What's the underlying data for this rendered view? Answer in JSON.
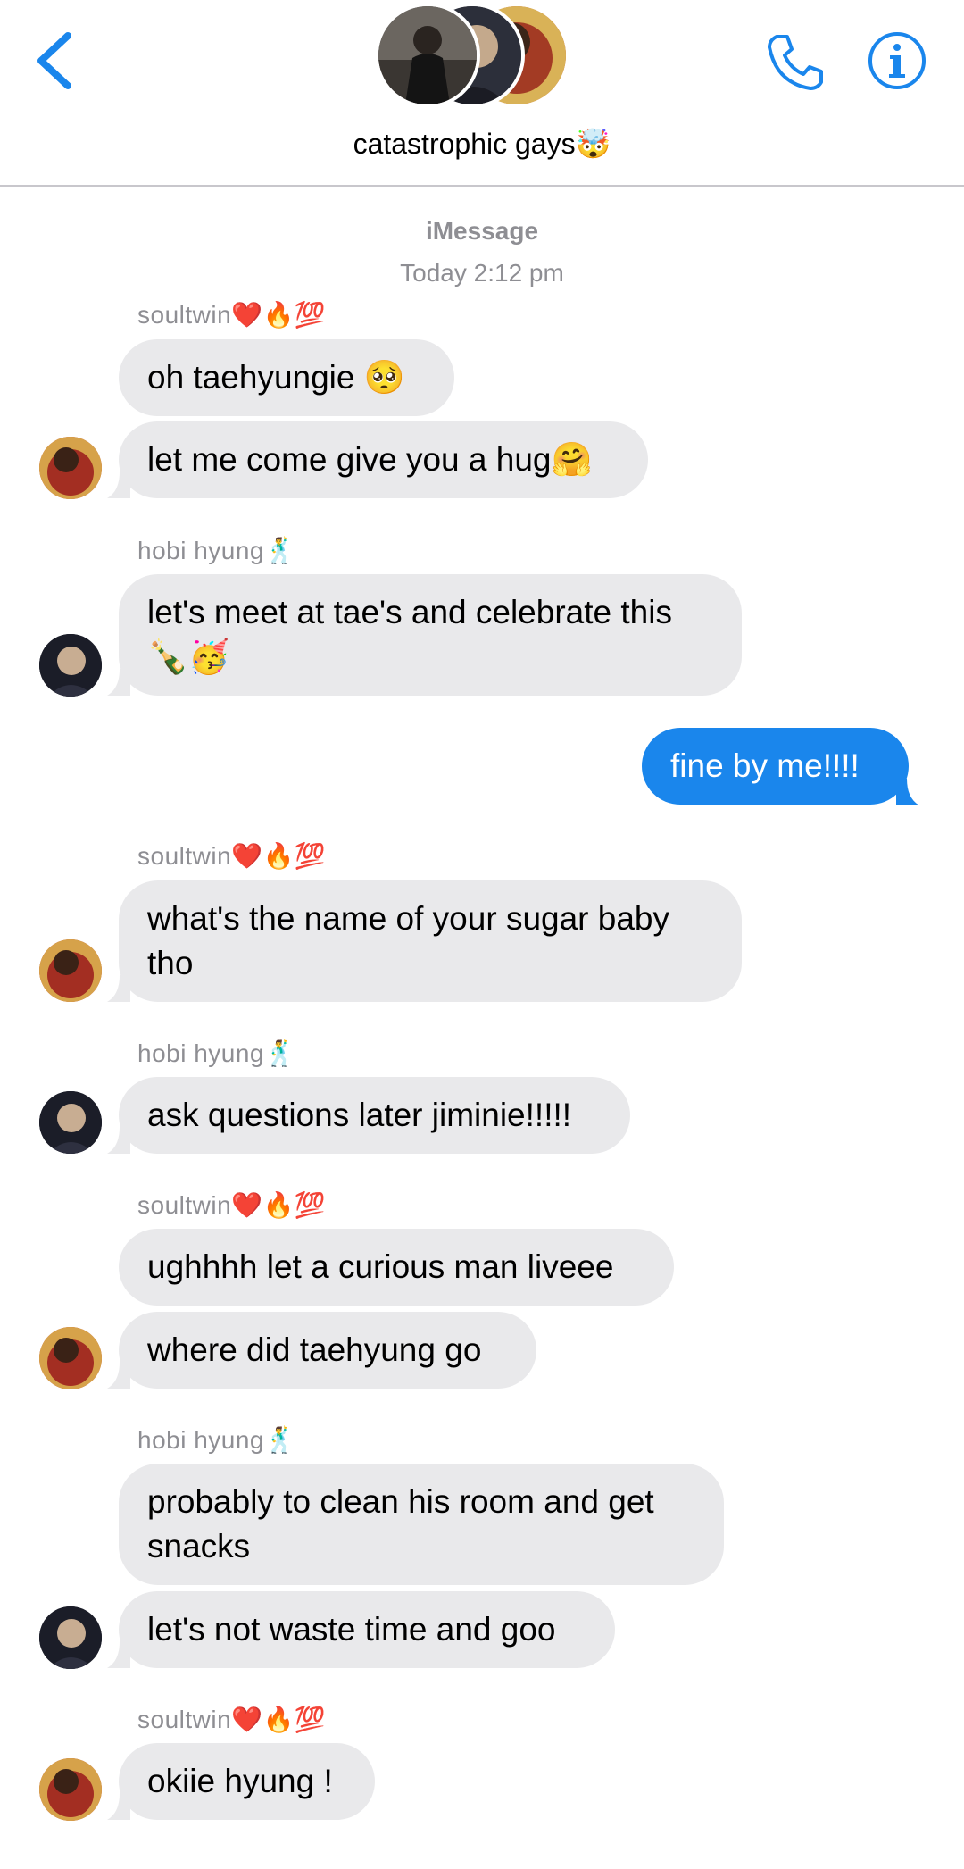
{
  "header": {
    "chat_title": "catastrophic gays🤯",
    "back_label": "Back",
    "colors": {
      "accent": "#1a86ec",
      "incoming_bubble": "#e9e9eb",
      "outgoing_bubble": "#1a86ec",
      "meta_text": "#8e8e93"
    }
  },
  "thread": {
    "service": "iMessage",
    "timestamp": "Today 2:12 pm"
  },
  "senders": {
    "soultwin": "soultwin❤️🔥💯",
    "hobi": "hobi hyung🕺"
  },
  "messages": [
    {
      "text": "oh taehyungie 🥺"
    },
    {
      "text": "let me come give you a hug🤗"
    },
    {
      "text": "let's meet at tae's and celebrate this 🍾🥳"
    },
    {
      "text": "fine by me!!!!"
    },
    {
      "text": "what's the name of your sugar baby tho"
    },
    {
      "text": "ask questions later jiminie!!!!!"
    },
    {
      "text": "ughhhh let a curious man liveee"
    },
    {
      "text": "where did taehyung go"
    },
    {
      "text": "probably to clean his room and get snacks"
    },
    {
      "text": "let's not waste time and goo"
    },
    {
      "text": "okiie hyung !"
    }
  ]
}
